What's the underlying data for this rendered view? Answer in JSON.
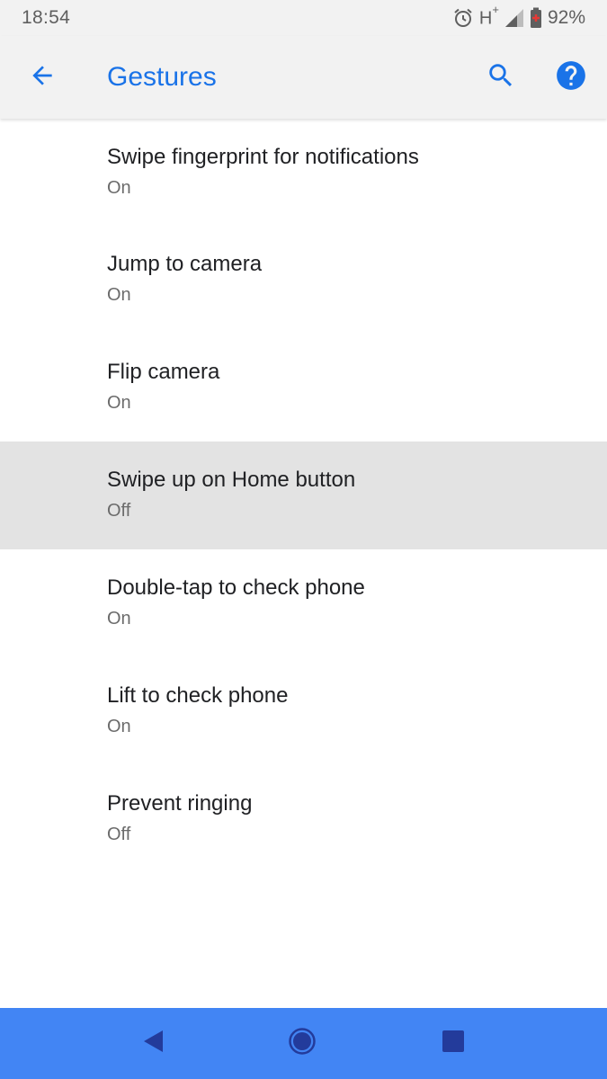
{
  "status_bar": {
    "time": "18:54",
    "network": "H",
    "network_sup": "+",
    "battery_percent": "92%"
  },
  "app_bar": {
    "title": "Gestures",
    "accent_color": "#1a73e8"
  },
  "icons": {
    "back": "arrow-back-icon",
    "search": "search-icon",
    "help": "help-icon",
    "alarm": "alarm-icon",
    "signal": "signal-icon",
    "battery": "battery-icon"
  },
  "gestures": {
    "items": [
      {
        "title": "Swipe fingerprint for notifications",
        "summary": "On"
      },
      {
        "title": "Jump to camera",
        "summary": "On"
      },
      {
        "title": "Flip camera",
        "summary": "On"
      },
      {
        "title": "Swipe up on Home button",
        "summary": "Off",
        "highlighted": true
      },
      {
        "title": "Double-tap to check phone",
        "summary": "On"
      },
      {
        "title": "Lift to check phone",
        "summary": "On"
      },
      {
        "title": "Prevent ringing",
        "summary": "Off"
      }
    ]
  },
  "nav_bar": {
    "color": "#4285f4"
  }
}
